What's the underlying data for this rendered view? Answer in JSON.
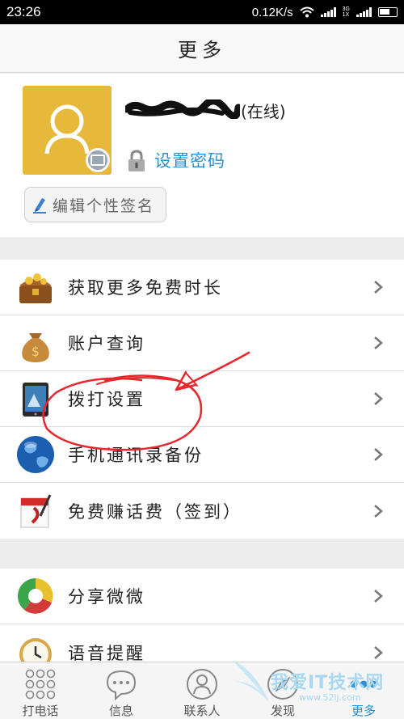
{
  "status_bar": {
    "time": "23:26",
    "speed": "0.12K/s",
    "net_top": "3G",
    "net_bottom": "1X",
    "icons": [
      "wifi-icon",
      "signal-icon",
      "signal-icon",
      "battery-icon"
    ]
  },
  "header": {
    "title": "更多"
  },
  "profile": {
    "status": "(在线)",
    "set_password": "设置密码",
    "edit_signature": "编辑个性签名",
    "avatar_color": "#e6b93b"
  },
  "menu_group_1": [
    {
      "label": "获取更多免费时长",
      "icon": "treasure-chest-icon"
    },
    {
      "label": "账户查询",
      "icon": "money-bag-icon"
    },
    {
      "label": "拨打设置",
      "icon": "phone-settings-icon"
    },
    {
      "label": "手机通讯录备份",
      "icon": "globe-icon"
    },
    {
      "label": "免费赚话费（签到）",
      "icon": "calendar-icon"
    }
  ],
  "menu_group_2": [
    {
      "label": "分享微微",
      "icon": "share-pie-icon"
    },
    {
      "label": "语音提醒",
      "icon": "alarm-clock-icon"
    }
  ],
  "tabs": [
    {
      "label": "打电话",
      "icon": "dialpad-icon"
    },
    {
      "label": "信息",
      "icon": "chat-icon"
    },
    {
      "label": "联系人",
      "icon": "contact-icon"
    },
    {
      "label": "发现",
      "icon": "compass-icon"
    },
    {
      "label": "更多",
      "icon": "more-dots-icon",
      "active": true
    }
  ],
  "watermark": {
    "text": "我爱IT技术网",
    "url": "www.52ij.com"
  },
  "colors": {
    "accent": "#2b8fd4",
    "annotation": "#e8262d"
  }
}
